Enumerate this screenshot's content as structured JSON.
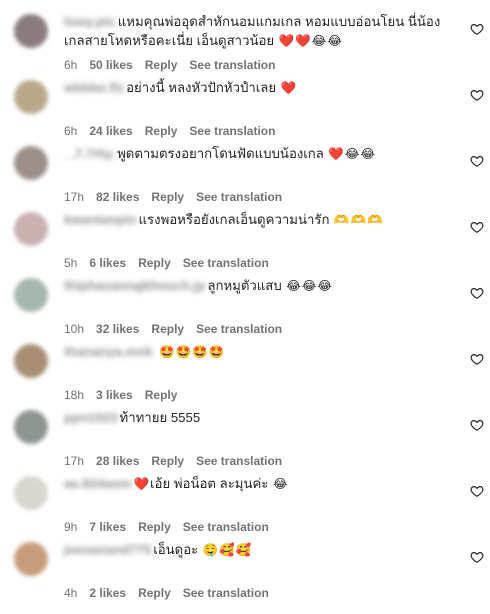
{
  "comments": [
    {
      "username": "lowy.ptc",
      "text": "แหมคุณพ่ออุดสำหักนอมแกมเกล หอมแบบอ่อนโยน นี่น้องเกลสายโหดหรือคะเนี่ย เอ็นดูสาวน้อย",
      "emoji": "❤️❤️😂😂",
      "time": "6h",
      "likes": "50 likes",
      "reply": "Reply",
      "see_translation": "See translation",
      "avatar_color": "#8a7b7f"
    },
    {
      "username": "wbbbe.flz",
      "text": "อย่างนี้ หลงหัวปักหัวปำเลย",
      "emoji": "❤️",
      "time": "6h",
      "likes": "24 likes",
      "reply": "Reply",
      "see_translation": "See translation",
      "avatar_color": "#b9a98a"
    },
    {
      "username": "_.7.7#ty.",
      "text": "พูดตามตรงอยากโดนฟัดแบบน้องเกล",
      "emoji": "❤️😂😂",
      "time": "17h",
      "likes": "82 likes",
      "reply": "Reply",
      "see_translation": "See translation",
      "avatar_color": "#9c8f89"
    },
    {
      "username": "kwantanpin",
      "text": "แรงพอหรือยังเกลเอ็นดูความน่ารัก",
      "emoji": "🫶🫶🫶",
      "time": "5h",
      "likes": "6 likes",
      "reply": "Reply",
      "see_translation": "See translation",
      "avatar_color": "#c9b1b0"
    },
    {
      "username": "thiphaoanngkhnuch.jp",
      "text": "ลูกหมูตัวแสบ",
      "emoji": "😂😂😂",
      "time": "10h",
      "likes": "32 likes",
      "reply": "Reply",
      "see_translation": "See translation",
      "avatar_color": "#a6b7ad"
    },
    {
      "username": "thananya.mnk",
      "text": "",
      "emoji": "🤩🤩🤩🤩",
      "time": "18h",
      "likes": "3 likes",
      "reply": "Reply",
      "see_translation": "",
      "avatar_color": "#a88e75"
    },
    {
      "username": "ppn1523",
      "text": "ท้าทายย 5555",
      "emoji": "",
      "time": "17h",
      "likes": "28 likes",
      "reply": "Reply",
      "see_translation": "See translation",
      "avatar_color": "#8e9591"
    },
    {
      "username": "ae.824aom",
      "text": "เอ้ย พ่อน็อต ละมุนค่ะ",
      "emoji_before": "❤️",
      "emoji": "😂",
      "time": "9h",
      "likes": "7 likes",
      "reply": "Reply",
      "see_translation": "See translation",
      "avatar_color": "#d9d5cf"
    },
    {
      "username": "joesanand775",
      "text": "เอ็นดูอะ",
      "emoji": "🤤🥰🥰",
      "time": "4h",
      "likes": "2 likes",
      "reply": "Reply",
      "see_translation": "See translation",
      "avatar_color": "#c79c7a"
    }
  ]
}
